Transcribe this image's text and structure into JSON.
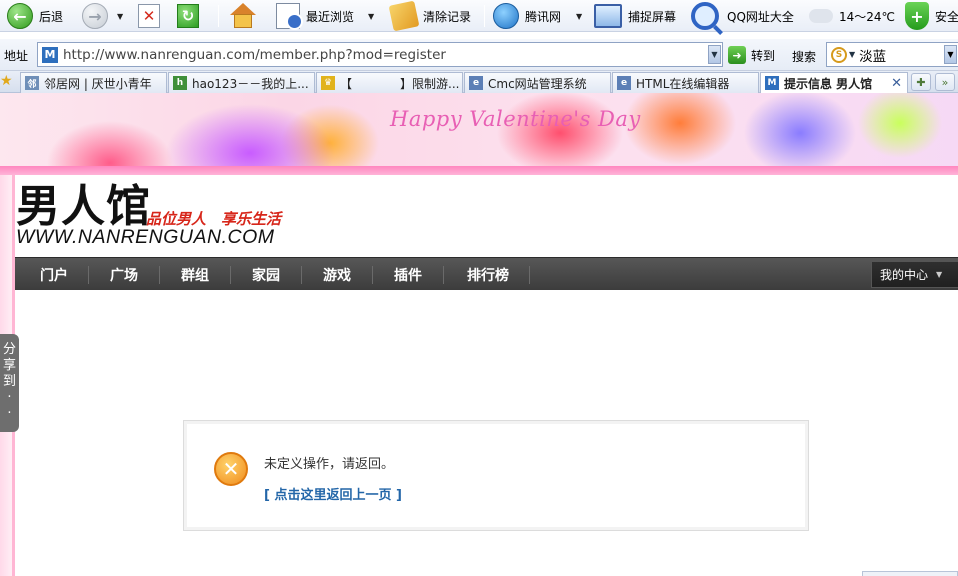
{
  "toolbar": {
    "back": "后退",
    "recent": "最近浏览",
    "clear": "清除记录",
    "tencent": "腾讯网",
    "capture": "捕捉屏幕",
    "qq_sites": "QQ网址大全",
    "weather": "14～24℃",
    "security": "安全"
  },
  "address": {
    "label": "地址",
    "url": "http://www.nanrenguan.com/member.php?mod=register",
    "go": "转到",
    "search_label": "搜索",
    "search_value": "淡蓝"
  },
  "tabs": [
    {
      "label": "邻居网 | 厌世小青年",
      "active": false
    },
    {
      "label": "hao123－－我的上...",
      "active": false
    },
    {
      "label": "【　　　　】限制游...",
      "active": false
    },
    {
      "label": "Cmc网站管理系统",
      "active": false
    },
    {
      "label": "HTML在线编辑器",
      "active": false
    },
    {
      "label": "提示信息 男人馆",
      "active": true
    }
  ],
  "banner": {
    "text": "Happy Valentine's Day"
  },
  "site": {
    "logo": "男人馆",
    "slogan_a": "品位男人",
    "slogan_b": "享乐生活",
    "url": "WWW.NANRENGUAN.COM"
  },
  "nav": {
    "items": [
      "门户",
      "广场",
      "群组",
      "家园",
      "游戏",
      "插件",
      "排行榜"
    ],
    "my_center": "我的中心"
  },
  "share": {
    "label": [
      "分",
      "享",
      "到",
      "·",
      "·"
    ]
  },
  "message": {
    "text": "未定义操作，请返回。",
    "link": "[ 点击这里返回上一页 ]"
  },
  "colors": {
    "nav_bg": "#4a4a4a",
    "link": "#2366a8",
    "warning": "#f08b1c",
    "banner_text": "#e85fb4"
  }
}
